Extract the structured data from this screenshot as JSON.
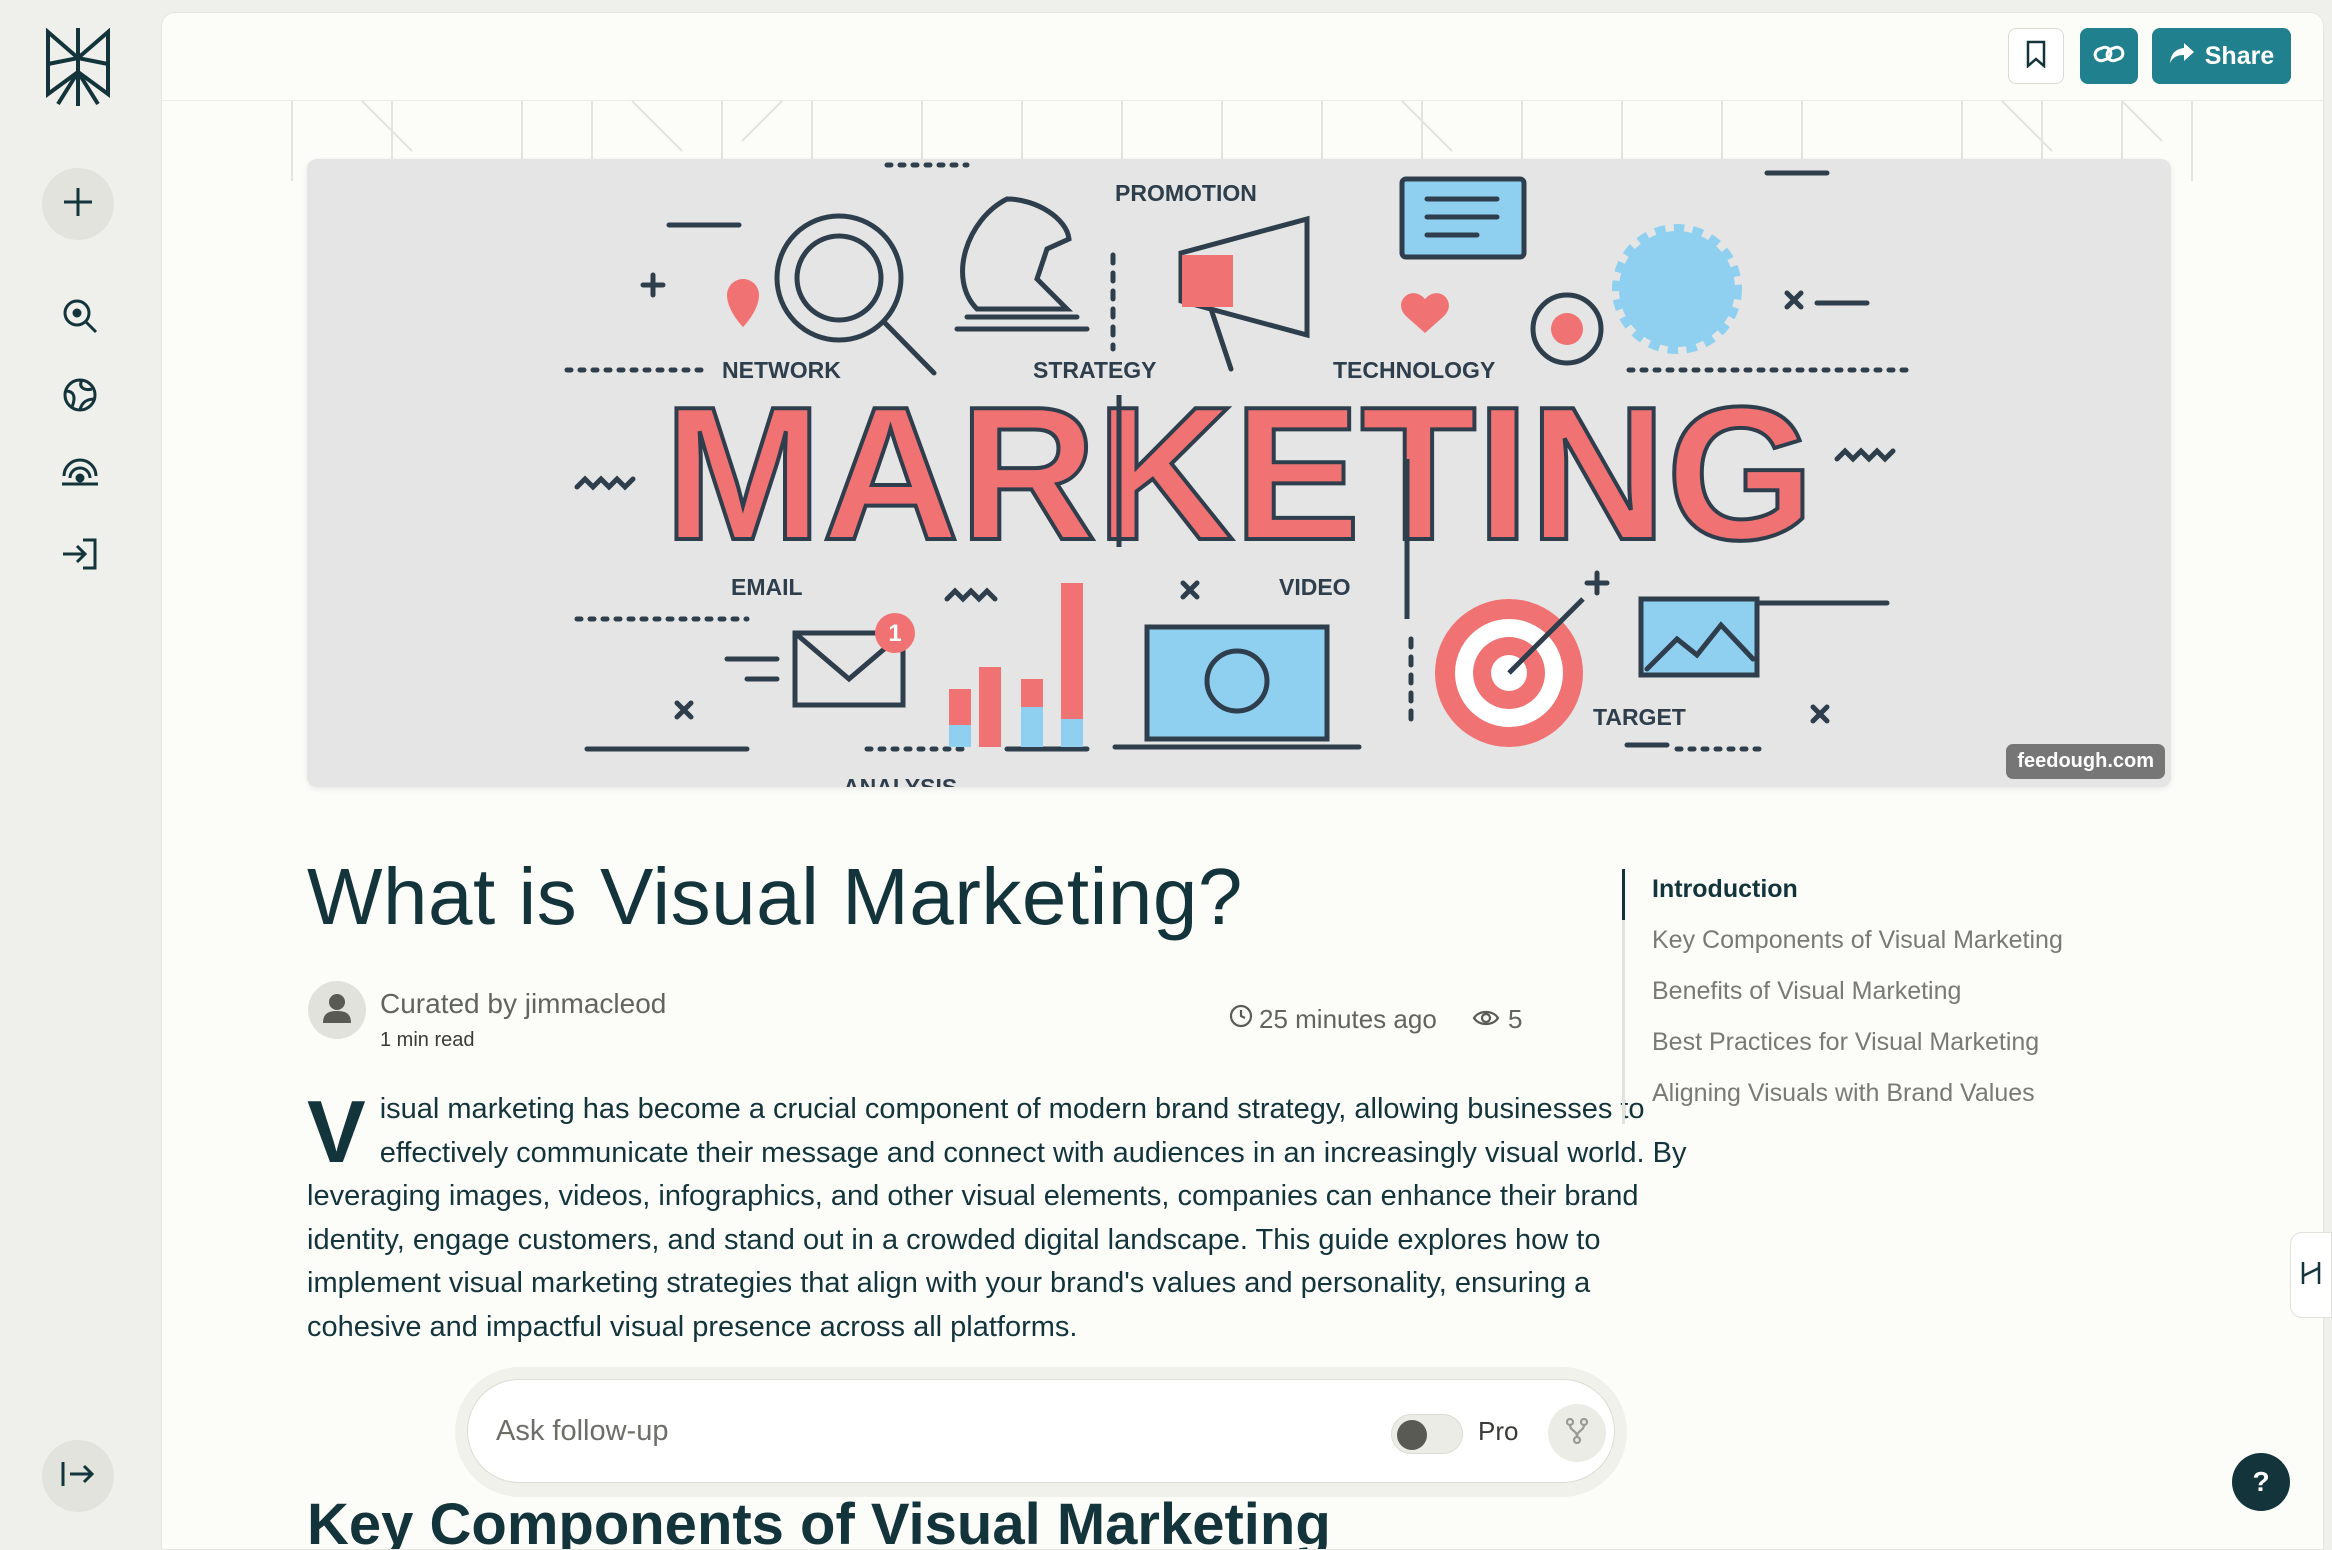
{
  "topbar": {
    "bookmark_icon": "bookmark-icon",
    "link_icon": "link-icon",
    "share_label": "Share"
  },
  "sidebar": {
    "items": [
      {
        "icon": "plus-icon"
      },
      {
        "icon": "search-icon"
      },
      {
        "icon": "globe-icon"
      },
      {
        "icon": "spaces-icon"
      },
      {
        "icon": "sign-in-icon"
      }
    ],
    "collapse_icon": "expand-icon"
  },
  "hero": {
    "source": "feedough.com",
    "words": {
      "network": "NETWORK",
      "strategy": "STRATEGY",
      "promotion": "PROMOTION",
      "technology": "TECHNOLOGY",
      "marketing": "MARKETING",
      "email": "EMAIL",
      "video": "VIDEO",
      "target": "TARGET",
      "analysis": "ANALYSIS",
      "badge": "1"
    }
  },
  "article": {
    "title": "What is Visual Marketing?",
    "curator": "Curated by jimmacleod",
    "read_time": "1 min read",
    "posted": "25 minutes ago",
    "views": "5",
    "dropcap": "V",
    "body": "isual marketing has become a crucial component of modern brand strategy, allowing businesses to effectively communicate their message and connect with audiences in an increasingly visual world. By leveraging images, videos, infographics, and other visual elements, companies can enhance their brand identity, engage customers, and stand out in a crowded digital landscape. This guide explores how to implement visual marketing strategies that align with your brand's values and personality, ensuring a cohesive and impactful visual presence across all platforms.",
    "next_heading": "Key Components of Visual Marketing"
  },
  "toc": [
    {
      "label": "Introduction",
      "active": true
    },
    {
      "label": "Key Components of Visual Marketing",
      "active": false
    },
    {
      "label": "Benefits of Visual Marketing",
      "active": false
    },
    {
      "label": "Best Practices for Visual Marketing",
      "active": false
    },
    {
      "label": "Aligning Visuals with Brand Values",
      "active": false
    }
  ],
  "followup": {
    "placeholder": "Ask follow-up",
    "pro_label": "Pro",
    "pro_enabled": false
  },
  "help_label": "?",
  "colors": {
    "accent": "#20808d",
    "ink": "#13343b",
    "coral": "#f07272",
    "sky": "#8fd0f0"
  }
}
